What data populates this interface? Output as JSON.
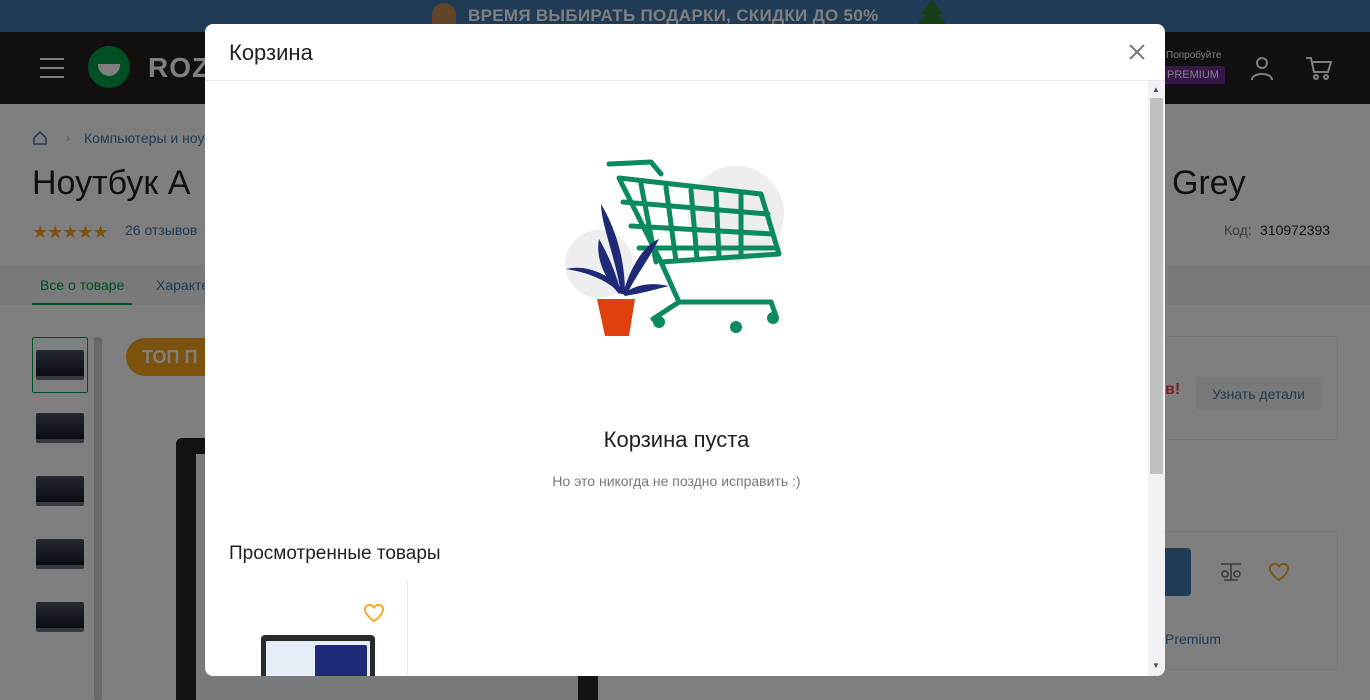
{
  "promo": {
    "text": "ВРЕМЯ ВЫБИРАТЬ ПОДАРКИ, СКИДКИ ДО 50%"
  },
  "header": {
    "logo_text": "ROZ",
    "premium_try": "Попробуйте",
    "premium_badge": "PREMIUM"
  },
  "breadcrumb": {
    "first": "Компьютеры и ноут"
  },
  "product": {
    "title_start": "Ноутбук А",
    "title_end": "Grey",
    "stars": "★★★★★",
    "reviews": "26 отзывов",
    "code_label": "Код:",
    "code_value": "310972393",
    "top_badge": "ТОП П",
    "exclamation": "в!",
    "learn_more": "Узнать детали",
    "premium_link": "Premium"
  },
  "tabs": {
    "about": "Все о товаре",
    "specs": "Характе"
  },
  "cart_modal": {
    "title": "Корзина",
    "empty_title": "Корзина пуста",
    "empty_subtitle": "Но это никогда не поздно исправить :)",
    "viewed_title": "Просмотренные товары"
  },
  "colors": {
    "accent_green": "#00a046",
    "link_blue": "#3e77aa",
    "header_dark": "#221f1f",
    "star_orange": "#f8a41b",
    "cart_illustration": "#0b8a5f",
    "plant_blue": "#1e2a78",
    "pot_red": "#e0400e"
  },
  "icons": {
    "close": "close-icon",
    "cart": "cart-icon",
    "user": "user-icon",
    "heart": "heart-icon",
    "menu": "burger-icon",
    "home": "home-icon"
  }
}
